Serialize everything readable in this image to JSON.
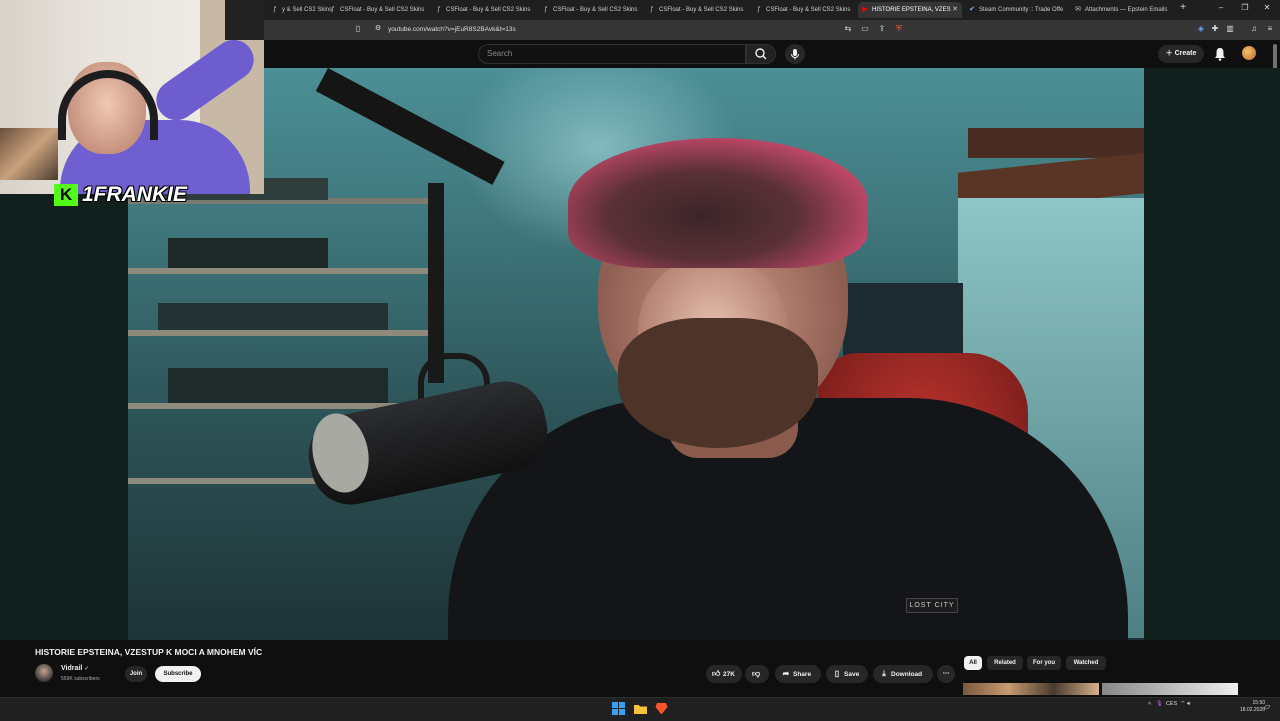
{
  "browser": {
    "tabs": [
      {
        "label": "y & Sell CS2 Skins",
        "icon": "csfloat-icon"
      },
      {
        "label": "CSFloat - Buy & Sell CS2 Skins",
        "icon": "csfloat-icon"
      },
      {
        "label": "CSFloat - Buy & Sell CS2 Skins",
        "icon": "csfloat-icon"
      },
      {
        "label": "CSFloat - Buy & Sell CS2 Skins",
        "icon": "csfloat-icon"
      },
      {
        "label": "CSFloat - Buy & Sell CS2 Skins",
        "icon": "csfloat-icon"
      },
      {
        "label": "CSFloat - Buy & Sell CS2 Skins",
        "icon": "csfloat-icon"
      },
      {
        "label": "HISTORIE EPSTEINA, VZES",
        "icon": "youtube-icon",
        "active": true
      },
      {
        "label": "Steam Community :: Trade Offe",
        "icon": "steam-icon"
      },
      {
        "label": "Attachments — Epstein Emails",
        "icon": "mail-icon"
      }
    ],
    "new_tab": "+",
    "url": "youtube.com/watch?v=jEuR8S2BAvk&t=13s"
  },
  "youtube": {
    "search_placeholder": "Search",
    "create_label": "Create",
    "video_title": "HISTORIE EPSTEINA, VZESTUP K MOCI A MNOHEM VÍC",
    "channel": {
      "name": "Vidrail",
      "subs": "559K subscribers"
    },
    "join_label": "Join",
    "subscribe_label": "Subscribe",
    "actions": {
      "likes": "27K",
      "share": "Share",
      "save": "Save",
      "download": "Download",
      "more": "⋯"
    },
    "chips": [
      "All",
      "Related",
      "For you",
      "Watched"
    ],
    "overlay": {
      "kick_logo": "K",
      "streamer": "1FRANKIE"
    },
    "video_badge": "LOST CITY"
  },
  "taskbar": {
    "lang": "CES",
    "time": "15:50",
    "date": "18.02.2026"
  },
  "colors": {
    "accent_kick": "#53fc18",
    "yt_red": "#ff0000",
    "brave_orange": "#fb542b"
  }
}
